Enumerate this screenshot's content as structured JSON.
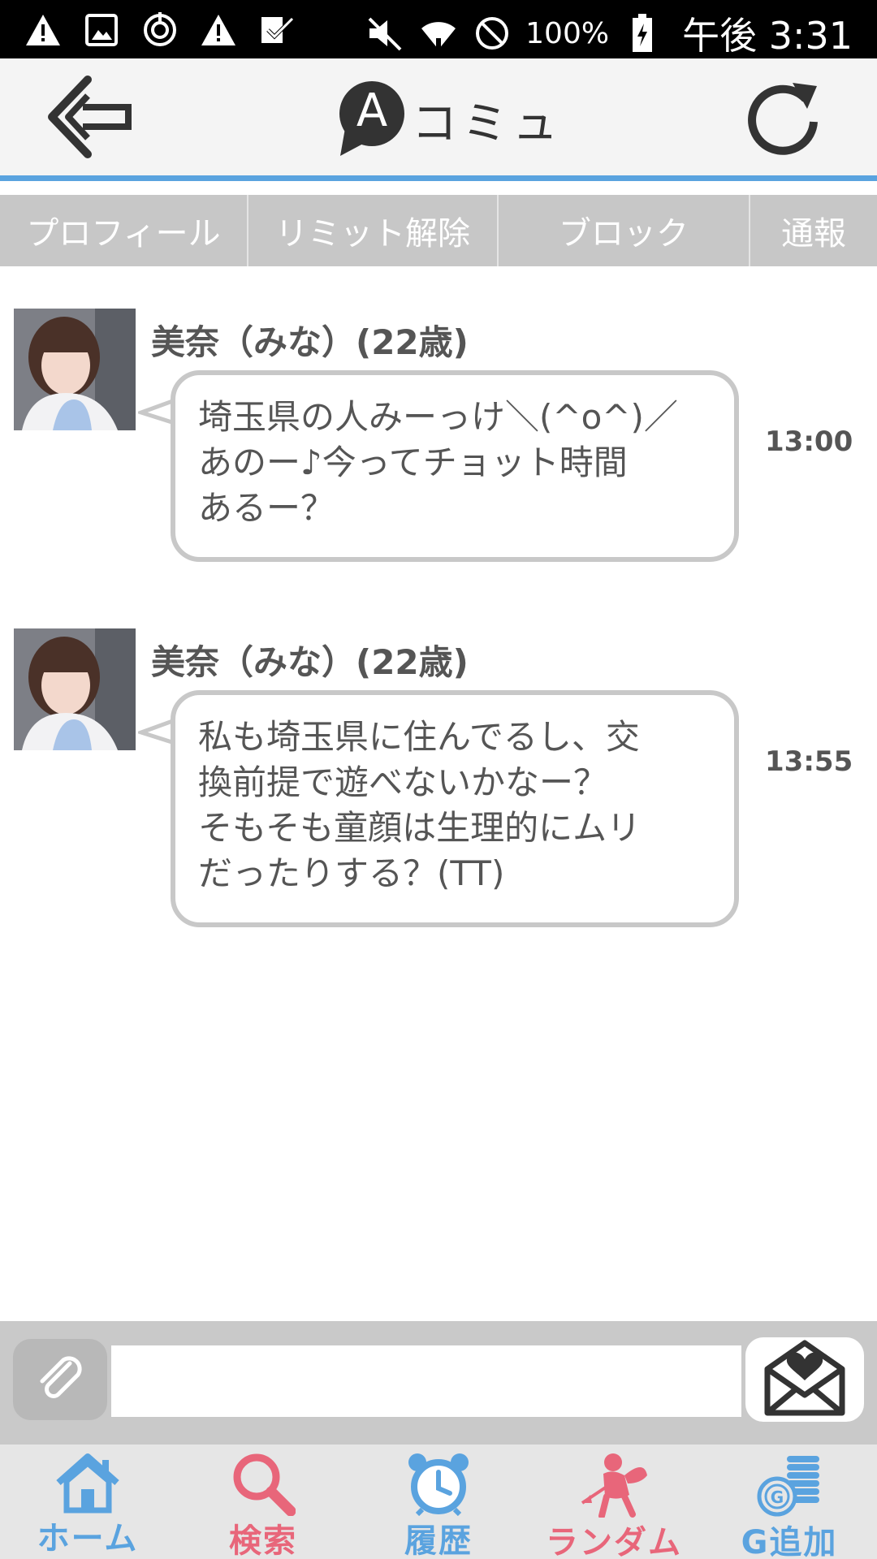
{
  "statusbar": {
    "battery_text": "100%",
    "time": "午後 3:31",
    "left_icons": [
      "warning-icon",
      "image-icon",
      "sync-icon",
      "warning-icon",
      "check-icon"
    ],
    "right_icons": [
      "mute-icon",
      "wifi-icon",
      "blocked-icon",
      "battery-icon"
    ]
  },
  "header": {
    "logo_letter": "A",
    "logo_text": "コミュ",
    "back_icon": "back-arrow-icon",
    "refresh_icon": "refresh-icon"
  },
  "tabs": [
    {
      "label": "プロフィール"
    },
    {
      "label": "リミット解除"
    },
    {
      "label": "ブロック"
    },
    {
      "label": "通報"
    }
  ],
  "messages": [
    {
      "sender": "美奈（みな）(22歳)",
      "text": "埼玉県の人みーっけ＼(^o^)／\nあのー♪今ってチョット時間\nあるー？",
      "time": "13:00"
    },
    {
      "sender": "美奈（みな）(22歳)",
      "text": "私も埼玉県に住んでるし、交\n換前提で遊べないかなー？\nそもそも童顔は生理的にムリ\nだったりする？(TT)",
      "time": "13:55"
    }
  ],
  "input": {
    "value": "",
    "attach_icon": "paperclip-icon",
    "send_icon": "envelope-heart-icon"
  },
  "nav": [
    {
      "label": "ホーム",
      "icon": "home-icon",
      "color": "#5aa3df"
    },
    {
      "label": "検索",
      "icon": "search-icon",
      "color": "#e8667a"
    },
    {
      "label": "履歴",
      "icon": "alarm-clock-icon",
      "color": "#5aa3df"
    },
    {
      "label": "ランダム",
      "icon": "cupid-icon",
      "color": "#e8667a"
    },
    {
      "label": "G追加",
      "icon": "coins-icon",
      "color": "#5aa3df"
    }
  ],
  "colors": {
    "accent_blue": "#5aa3df",
    "accent_pink": "#e8667a",
    "tab_bg": "#c7c7c7",
    "bubble_border": "#c8c8c8"
  }
}
